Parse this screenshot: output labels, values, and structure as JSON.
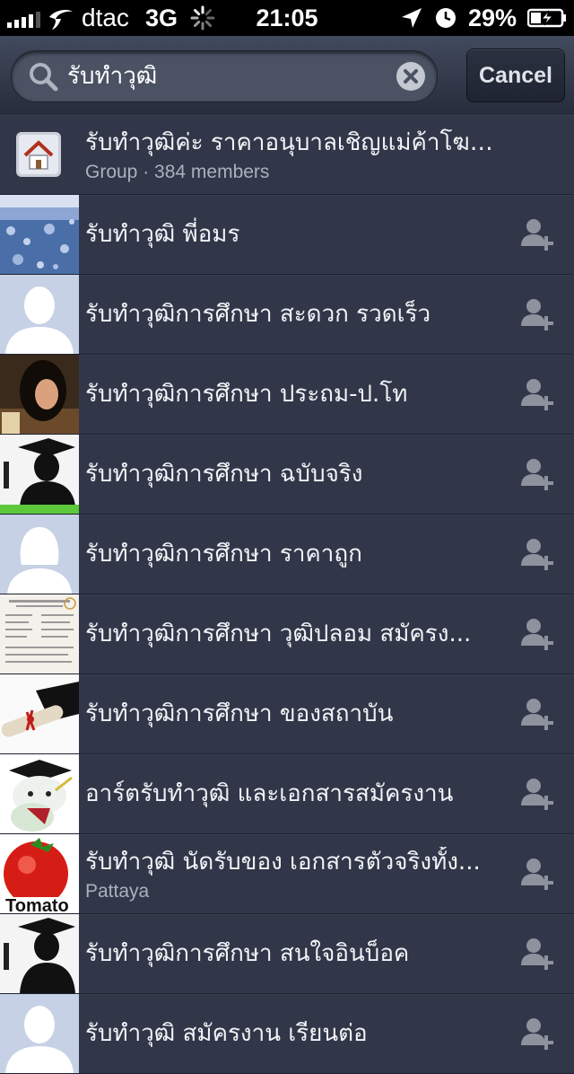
{
  "status_bar": {
    "carrier": "dtac",
    "network": "3G",
    "time": "21:05",
    "battery": "29%"
  },
  "search": {
    "query": "รับทำวุฒิ",
    "cancel_label": "Cancel"
  },
  "results": [
    {
      "title": "รับทำวุฒิค่ะ ราคาอนุบาลเชิญแม่ค้าโฆษน...",
      "subtitle": "Group · 384 members",
      "thumb": "group-icon"
    },
    {
      "title": "รับทำวุฒิ พี่อมร",
      "thumb": "water-drops"
    },
    {
      "title": "รับทำวุฒิการศึกษา สะดวก รวดเร็ว",
      "thumb": "default-male"
    },
    {
      "title": "รับทำวุฒิการศึกษา ประถม-ป.โท",
      "thumb": "woman-photo"
    },
    {
      "title": "รับทำวุฒิการศึกษา ฉบับจริง",
      "thumb": "graduate-silhouette"
    },
    {
      "title": "รับทำวุฒิการศึกษา ราคาถูก",
      "thumb": "default-female"
    },
    {
      "title": "รับทำวุฒิการศึกษา วุฒิปลอม สมัครง...",
      "thumb": "certificate"
    },
    {
      "title": "รับทำวุฒิการศึกษา ของสถาบัน",
      "thumb": "diploma-scroll"
    },
    {
      "title": "อาร์ตรับทำวุฒิ และเอกสารสมัครงาน",
      "thumb": "plush-graduate"
    },
    {
      "title": "รับทำวุฒิ นัดรับของ เอกสารตัวจริงทั้ง...",
      "subtitle": "Pattaya",
      "thumb": "tomato-logo",
      "thumb_text": "Tomato"
    },
    {
      "title": "รับทำวุฒิการศึกษา สนใจอินบ็อค",
      "thumb": "graduate-silhouette"
    },
    {
      "title": "รับทำวุฒิ สมัครงาน เรียนต่อ",
      "thumb": "default-male"
    }
  ],
  "colors": {
    "background": "#313749",
    "status_bar": "#000000",
    "text": "#f2f3f6",
    "subtext": "#aab0bd"
  }
}
